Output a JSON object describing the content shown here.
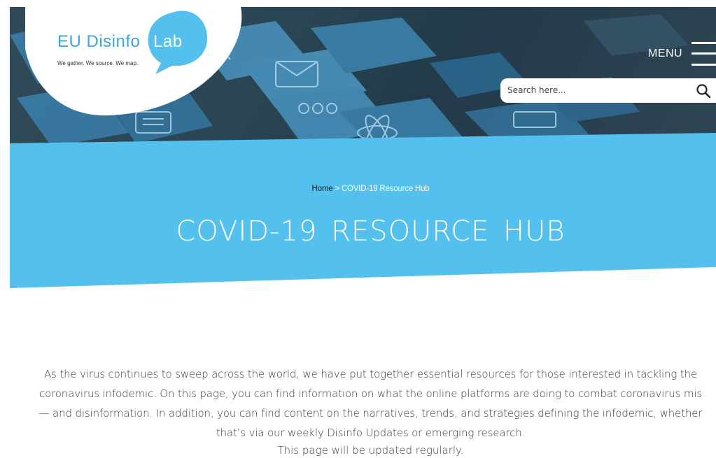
{
  "brand": {
    "name_part1": "EU Disinfo",
    "name_part2": "Lab",
    "tagline": "We gather. We source. We map.",
    "primary_color": "#53c0ee",
    "logo_text_color": "#3aa7dd"
  },
  "header": {
    "menu_label": "MENU",
    "menu_icon": "hamburger-icon",
    "search": {
      "placeholder": "Search here...",
      "value": "",
      "icon": "search-icon"
    }
  },
  "hero": {
    "breadcrumb": {
      "home": "Home",
      "separator": ">",
      "current": "COVID-19 Resource Hub"
    },
    "title": "COVID-19 RESOURCE HUB",
    "background_color": "#53c0ee"
  },
  "content": {
    "intro": "As the virus continues to sweep across the world, we have put together essential resources for those interested in tackling the coronavirus infodemic. On this page, you can find information on what the online platforms are doing to combat coronavirus mis— and disinformation. In addition, you can find content on the narratives, trends, and strategies defining the infodemic, whether that’s via our weekly Disinfo Updates or emerging research.",
    "update_note": "This page will be updated regularly."
  }
}
